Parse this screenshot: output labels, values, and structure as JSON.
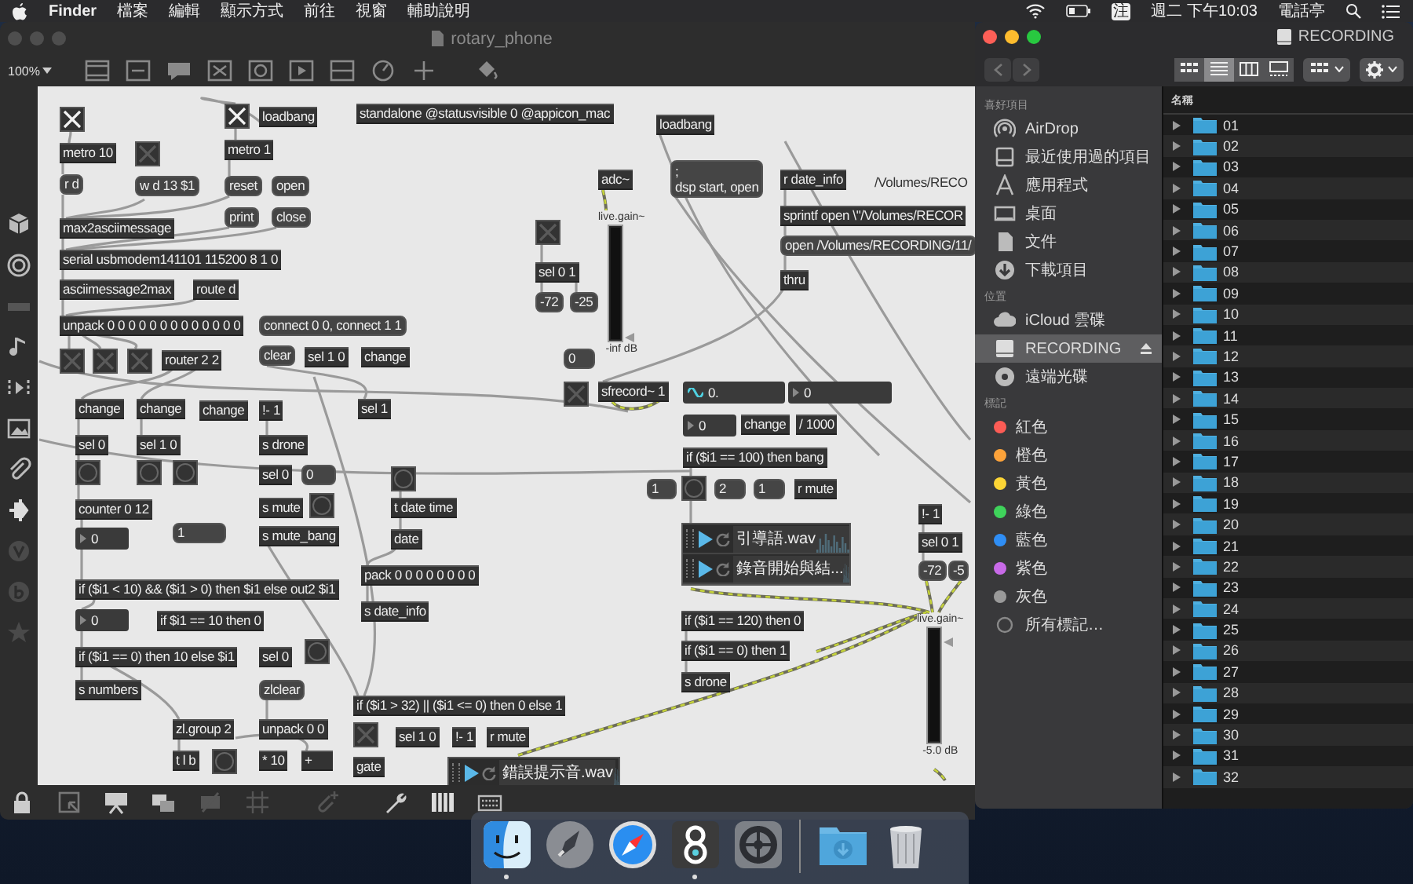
{
  "menu_bar": {
    "app": "Finder",
    "menus": [
      "檔案",
      "編輯",
      "顯示方式",
      "前往",
      "視窗",
      "輔助說明"
    ],
    "input_source": "注",
    "clock": "週二 下午10:03",
    "user": "電話亭"
  },
  "patcher": {
    "title": "rotary_phone",
    "zoom": "100%",
    "objects": [
      {
        "kind": "toggle",
        "checked": true
      },
      {
        "kind": "toggle",
        "checked": true
      },
      {
        "kind": "object",
        "text": "loadbang"
      },
      {
        "kind": "object",
        "text": "standalone @statusvisible 0 @appicon_mac"
      },
      {
        "kind": "object",
        "text": "loadbang"
      },
      {
        "kind": "object",
        "text": "metro 10"
      },
      {
        "kind": "toggle",
        "checked": false
      },
      {
        "kind": "object",
        "text": "metro 1"
      },
      {
        "kind": "message",
        "text": "r d"
      },
      {
        "kind": "message",
        "text": "w d 13 $1"
      },
      {
        "kind": "message",
        "text": "reset"
      },
      {
        "kind": "message",
        "text": "open"
      },
      {
        "kind": "object",
        "text": "adc~"
      },
      {
        "kind": "message",
        "text": ";\ndsp start, open"
      },
      {
        "kind": "object",
        "text": "r date_info"
      },
      {
        "kind": "comment",
        "text": "/Volumes/RECO"
      },
      {
        "kind": "message",
        "text": "print"
      },
      {
        "kind": "message",
        "text": "close"
      },
      {
        "kind": "toggle",
        "checked": false
      },
      {
        "kind": "gain",
        "label": "live.gain~",
        "level": 0,
        "reading": "-inf dB"
      },
      {
        "kind": "object",
        "text": "sprintf open \\\"/Volumes/RECOR"
      },
      {
        "kind": "object",
        "text": "max2asciimessage"
      },
      {
        "kind": "message",
        "text": "open /Volumes/RECORDING/11/"
      },
      {
        "kind": "object",
        "text": "serial usbmodem141101 115200 8 1 0"
      },
      {
        "kind": "object",
        "text": "sel 0 1"
      },
      {
        "kind": "object",
        "text": "thru"
      },
      {
        "kind": "object",
        "text": "asciimessage2max"
      },
      {
        "kind": "object",
        "text": "route d"
      },
      {
        "kind": "message",
        "text": "-72"
      },
      {
        "kind": "message",
        "text": "-25"
      },
      {
        "kind": "object",
        "text": "unpack 0 0 0 0 0 0 0 0 0 0 0 0 0"
      },
      {
        "kind": "message",
        "text": "connect 0 0, connect 1 1"
      },
      {
        "kind": "toggle",
        "checked": false
      },
      {
        "kind": "toggle",
        "checked": false
      },
      {
        "kind": "toggle",
        "checked": false
      },
      {
        "kind": "object",
        "text": "router 2 2"
      },
      {
        "kind": "message",
        "text": "clear"
      },
      {
        "kind": "object",
        "text": "sel 1 0"
      },
      {
        "kind": "object",
        "text": "change"
      },
      {
        "kind": "message",
        "text": "0"
      },
      {
        "kind": "toggle",
        "checked": false
      },
      {
        "kind": "object",
        "text": "sfrecord~ 1"
      },
      {
        "kind": "signal-number",
        "text": "0."
      },
      {
        "kind": "number",
        "text": "0"
      },
      {
        "kind": "object",
        "text": "change"
      },
      {
        "kind": "object",
        "text": "change"
      },
      {
        "kind": "object",
        "text": "change"
      },
      {
        "kind": "object",
        "text": "!- 1"
      },
      {
        "kind": "object",
        "text": "sel 1"
      },
      {
        "kind": "number",
        "text": "0"
      },
      {
        "kind": "object",
        "text": "change"
      },
      {
        "kind": "object",
        "text": "/ 1000"
      },
      {
        "kind": "object",
        "text": "sel 0"
      },
      {
        "kind": "object",
        "text": "sel 1 0"
      },
      {
        "kind": "object",
        "text": "s drone"
      },
      {
        "kind": "object",
        "text": "if ($i1 == 100) then bang"
      },
      {
        "kind": "bang"
      },
      {
        "kind": "bang"
      },
      {
        "kind": "bang"
      },
      {
        "kind": "object",
        "text": "sel 0"
      },
      {
        "kind": "message",
        "text": "0"
      },
      {
        "kind": "bang"
      },
      {
        "kind": "message",
        "text": "1"
      },
      {
        "kind": "bang"
      },
      {
        "kind": "message",
        "text": "2"
      },
      {
        "kind": "message",
        "text": "1"
      },
      {
        "kind": "object",
        "text": "r mute"
      },
      {
        "kind": "object",
        "text": "counter 0 12"
      },
      {
        "kind": "object",
        "text": "s mute"
      },
      {
        "kind": "bang"
      },
      {
        "kind": "object",
        "text": "t date time"
      },
      {
        "kind": "object",
        "text": "!- 1"
      },
      {
        "kind": "number",
        "text": "0"
      },
      {
        "kind": "message",
        "text": "1"
      },
      {
        "kind": "object",
        "text": "s mute_bang"
      },
      {
        "kind": "object",
        "text": "date"
      },
      {
        "kind": "object",
        "text": "pack 0 0 0 0 0 0 0 0"
      },
      {
        "kind": "playlist",
        "files": [
          "引導語.wav",
          "錄音開始與結..."
        ]
      },
      {
        "kind": "object",
        "text": "sel 0 1"
      },
      {
        "kind": "message",
        "text": "-72"
      },
      {
        "kind": "message",
        "text": "-5"
      },
      {
        "kind": "object",
        "text": "if ($i1 < 10) && ($i1 > 0) then $i1 else out2 $i1"
      },
      {
        "kind": "object",
        "text": "s date_info"
      },
      {
        "kind": "number",
        "text": "0"
      },
      {
        "kind": "object",
        "text": "if $i1 == 10 then 0"
      },
      {
        "kind": "object",
        "text": "if ($i1 == 120) then 0"
      },
      {
        "kind": "object",
        "text": "if ($i1 == 0) then 10 else $i1"
      },
      {
        "kind": "object",
        "text": "sel 0"
      },
      {
        "kind": "bang"
      },
      {
        "kind": "object",
        "text": "if ($i1 == 0) then 1"
      },
      {
        "kind": "object",
        "text": "s numbers"
      },
      {
        "kind": "message",
        "text": "zlclear"
      },
      {
        "kind": "object",
        "text": "s drone"
      },
      {
        "kind": "object",
        "text": "if ($i1 > 32) || ($i1 <= 0) then 0 else 1"
      },
      {
        "kind": "object",
        "text": "zl.group 2"
      },
      {
        "kind": "object",
        "text": "unpack 0 0"
      },
      {
        "kind": "toggle",
        "checked": false
      },
      {
        "kind": "object",
        "text": "sel 1 0"
      },
      {
        "kind": "object",
        "text": "!- 1"
      },
      {
        "kind": "object",
        "text": "r mute"
      },
      {
        "kind": "object",
        "text": "t l b"
      },
      {
        "kind": "bang"
      },
      {
        "kind": "object",
        "text": "* 10"
      },
      {
        "kind": "object",
        "text": "+"
      },
      {
        "kind": "object",
        "text": "gate"
      },
      {
        "kind": "playlist",
        "files": [
          "錯誤提示音.wav"
        ]
      },
      {
        "kind": "gain",
        "label": "live.gain~",
        "level": 0.9,
        "reading": "-5.0 dB"
      }
    ]
  },
  "finder": {
    "title": "RECORDING",
    "view_modes": [
      {
        "selected": false
      },
      {
        "selected": true
      },
      {
        "selected": false
      },
      {
        "selected": false
      }
    ],
    "sidebar": [
      {
        "heading": "喜好項目",
        "items": [
          {
            "label": "AirDrop",
            "selected": false
          },
          {
            "label": "最近使用過的項目",
            "selected": false
          },
          {
            "label": "應用程式",
            "selected": false
          },
          {
            "label": "桌面",
            "selected": false
          },
          {
            "label": "文件",
            "selected": false
          },
          {
            "label": "下載項目",
            "selected": false
          }
        ]
      },
      {
        "heading": "位置",
        "items": [
          {
            "label": "iCloud 雲碟",
            "selected": false
          },
          {
            "label": "RECORDING",
            "selected": true,
            "ejectable": true
          },
          {
            "label": "遠端光碟",
            "selected": false
          }
        ]
      },
      {
        "heading": "標記",
        "items": [
          {
            "label": "紅色",
            "color": "#fc5c55",
            "selected": false
          },
          {
            "label": "橙色",
            "color": "#fda33a",
            "selected": false
          },
          {
            "label": "黃色",
            "color": "#fcd535",
            "selected": false
          },
          {
            "label": "綠色",
            "color": "#3fd35b",
            "selected": false
          },
          {
            "label": "藍色",
            "color": "#2f8ef5",
            "selected": false
          },
          {
            "label": "紫色",
            "color": "#c86ae8",
            "selected": false
          },
          {
            "label": "灰色",
            "color": "#9a9a9a",
            "selected": false
          },
          {
            "label": "所有標記…",
            "selected": false
          }
        ]
      }
    ],
    "column": "名稱",
    "rows": [
      {
        "name": "01",
        "expanded": false
      },
      {
        "name": "02",
        "expanded": false
      },
      {
        "name": "03",
        "expanded": false
      },
      {
        "name": "04",
        "expanded": false
      },
      {
        "name": "05",
        "expanded": false
      },
      {
        "name": "06",
        "expanded": false
      },
      {
        "name": "07",
        "expanded": false
      },
      {
        "name": "08",
        "expanded": false
      },
      {
        "name": "09",
        "expanded": false
      },
      {
        "name": "10",
        "expanded": false
      },
      {
        "name": "11",
        "expanded": false
      },
      {
        "name": "12",
        "expanded": false
      },
      {
        "name": "13",
        "expanded": false
      },
      {
        "name": "14",
        "expanded": false
      },
      {
        "name": "15",
        "expanded": false
      },
      {
        "name": "16",
        "expanded": false
      },
      {
        "name": "17",
        "expanded": false
      },
      {
        "name": "18",
        "expanded": false
      },
      {
        "name": "19",
        "expanded": false
      },
      {
        "name": "20",
        "expanded": false
      },
      {
        "name": "21",
        "expanded": false
      },
      {
        "name": "22",
        "expanded": false
      },
      {
        "name": "23",
        "expanded": false
      },
      {
        "name": "24",
        "expanded": false
      },
      {
        "name": "25",
        "expanded": false
      },
      {
        "name": "26",
        "expanded": false
      },
      {
        "name": "27",
        "expanded": false
      },
      {
        "name": "28",
        "expanded": false
      },
      {
        "name": "29",
        "expanded": false
      },
      {
        "name": "30",
        "expanded": false
      },
      {
        "name": "31",
        "expanded": false
      },
      {
        "name": "32",
        "expanded": false
      }
    ]
  },
  "dock": {
    "apps": [
      {
        "running": true
      },
      {
        "running": false
      },
      {
        "running": false
      },
      {
        "running": true
      },
      {
        "running": false
      },
      {
        "running": false
      },
      {
        "running": false
      }
    ]
  }
}
